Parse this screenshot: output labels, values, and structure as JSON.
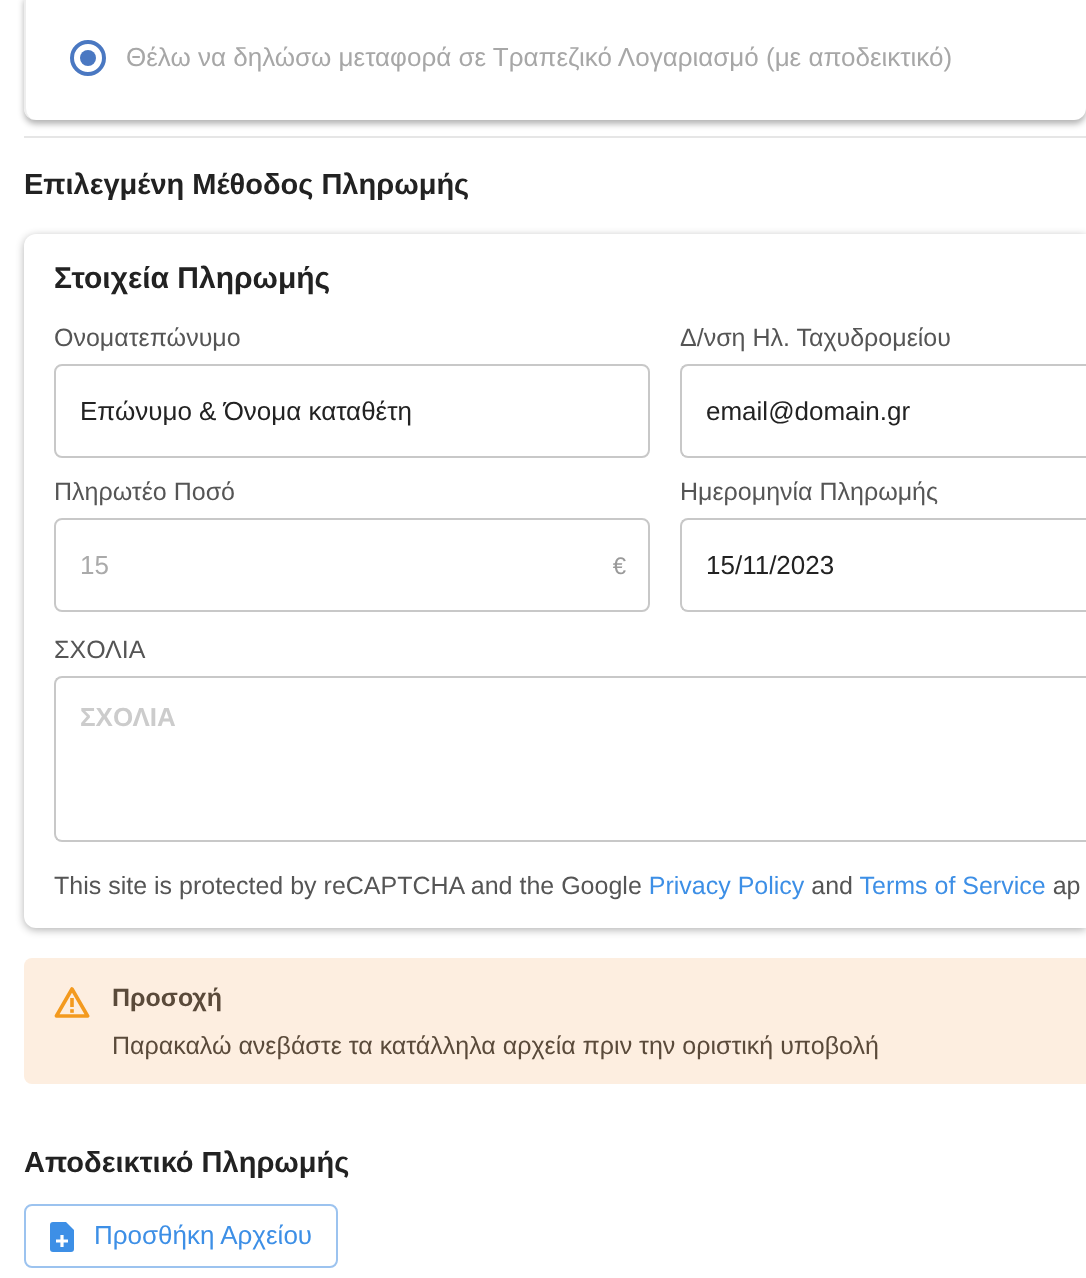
{
  "payment_option": {
    "label": "Θέλω να δηλώσω μεταφορά σε Τραπεζικό Λογαριασμό (με αποδεικτικό)",
    "selected": true
  },
  "section_title": "Επιλεγμένη Μέθοδος Πληρωμής",
  "details_card": {
    "title": "Στοιχεία Πληρωμής",
    "fields": [
      {
        "label": "Ονοματεπώνυμο",
        "value": "Επώνυμο & Όνομα καταθέτη",
        "disabled": false
      },
      {
        "label": "Δ/νση Ηλ. Ταχυδρομείου",
        "value": "email@domain.gr",
        "disabled": false
      },
      {
        "label": "Πληρωτέο Ποσό",
        "value": "15",
        "suffix": "€",
        "disabled": true
      },
      {
        "label": "Ημερομηνία Πληρωμής",
        "value": "15/11/2023",
        "disabled": false
      }
    ],
    "comments": {
      "label": "ΣΧΟΛΙΑ",
      "placeholder": "ΣΧΟΛΙΑ"
    },
    "notice": [
      {
        "kind": "text",
        "text": "This site is protected by reCAPTCHA and the Google "
      },
      {
        "kind": "link",
        "text": "Privacy Policy"
      },
      {
        "kind": "text",
        "text": " and "
      },
      {
        "kind": "link",
        "text": "Terms of Service"
      },
      {
        "kind": "text",
        "text": " ap"
      }
    ]
  },
  "alert": {
    "title": "Προσοχή",
    "message": "Παρακαλώ ανεβάστε τα κατάλληλα αρχεία πριν την οριστική υποβολή"
  },
  "upload": {
    "title": "Αποδεικτικό Πληρωμής",
    "button": "Προσθήκη Αρχείου"
  }
}
